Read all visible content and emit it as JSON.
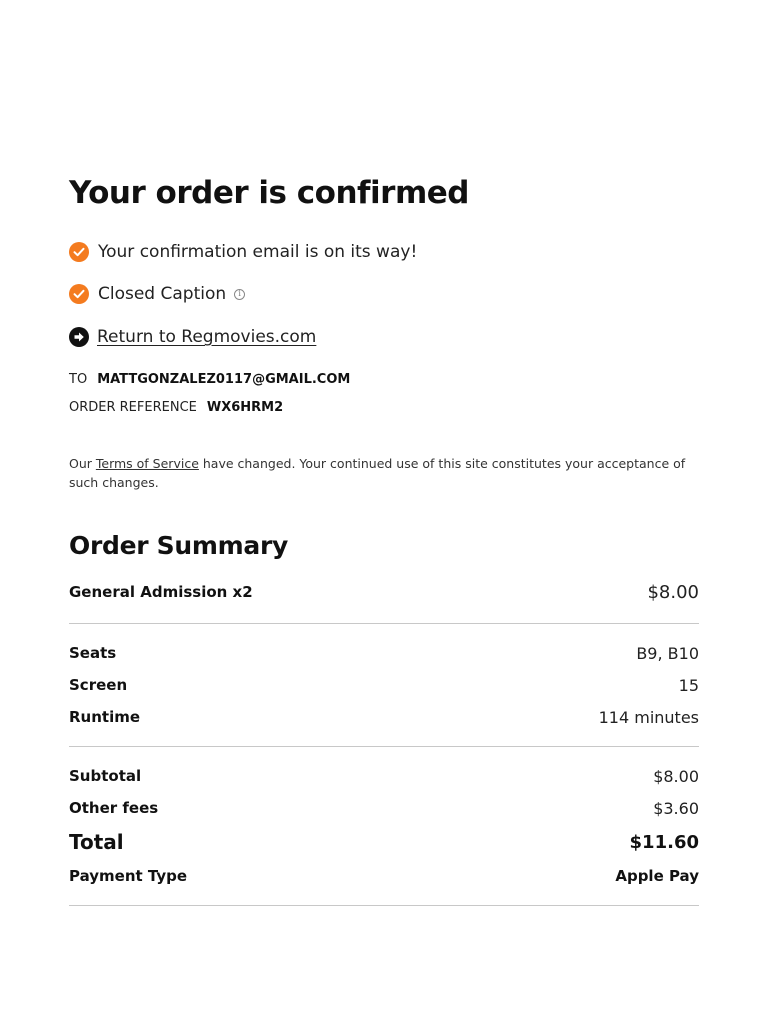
{
  "confirmation": {
    "title": "Your order is confirmed",
    "email_status": "Your confirmation email is on its way!",
    "closed_caption": "Closed Caption",
    "return_link": "Return to Regmovies.com"
  },
  "order_meta": {
    "to_label": "TO",
    "to_value": "MATTGONZALEZ0117@GMAIL.COM",
    "ref_label": "ORDER REFERENCE",
    "ref_value": "WX6HRM2"
  },
  "tos": {
    "prefix": "Our ",
    "link": "Terms of Service",
    "suffix": " have changed. Your continued use of this site constitutes your acceptance of such changes."
  },
  "summary": {
    "title": "Order Summary",
    "ticket": {
      "label": "General Admission x2",
      "value": "$8.00"
    },
    "details": [
      {
        "label": "Seats",
        "value": "B9, B10"
      },
      {
        "label": "Screen",
        "value": "15"
      },
      {
        "label": "Runtime",
        "value": "114 minutes"
      }
    ],
    "subtotal": {
      "label": "Subtotal",
      "value": "$8.00"
    },
    "fees": {
      "label": "Other fees",
      "value": "$3.60"
    },
    "total": {
      "label": "Total",
      "value": "$11.60"
    },
    "payment": {
      "label": "Payment Type",
      "value": "Apple Pay"
    }
  },
  "colors": {
    "accent": "#f47b1f",
    "divider": "#c8c8c8"
  },
  "icons": {
    "check": "check-circle-icon",
    "info": "info-icon",
    "arrow": "arrow-right-circle-icon"
  }
}
